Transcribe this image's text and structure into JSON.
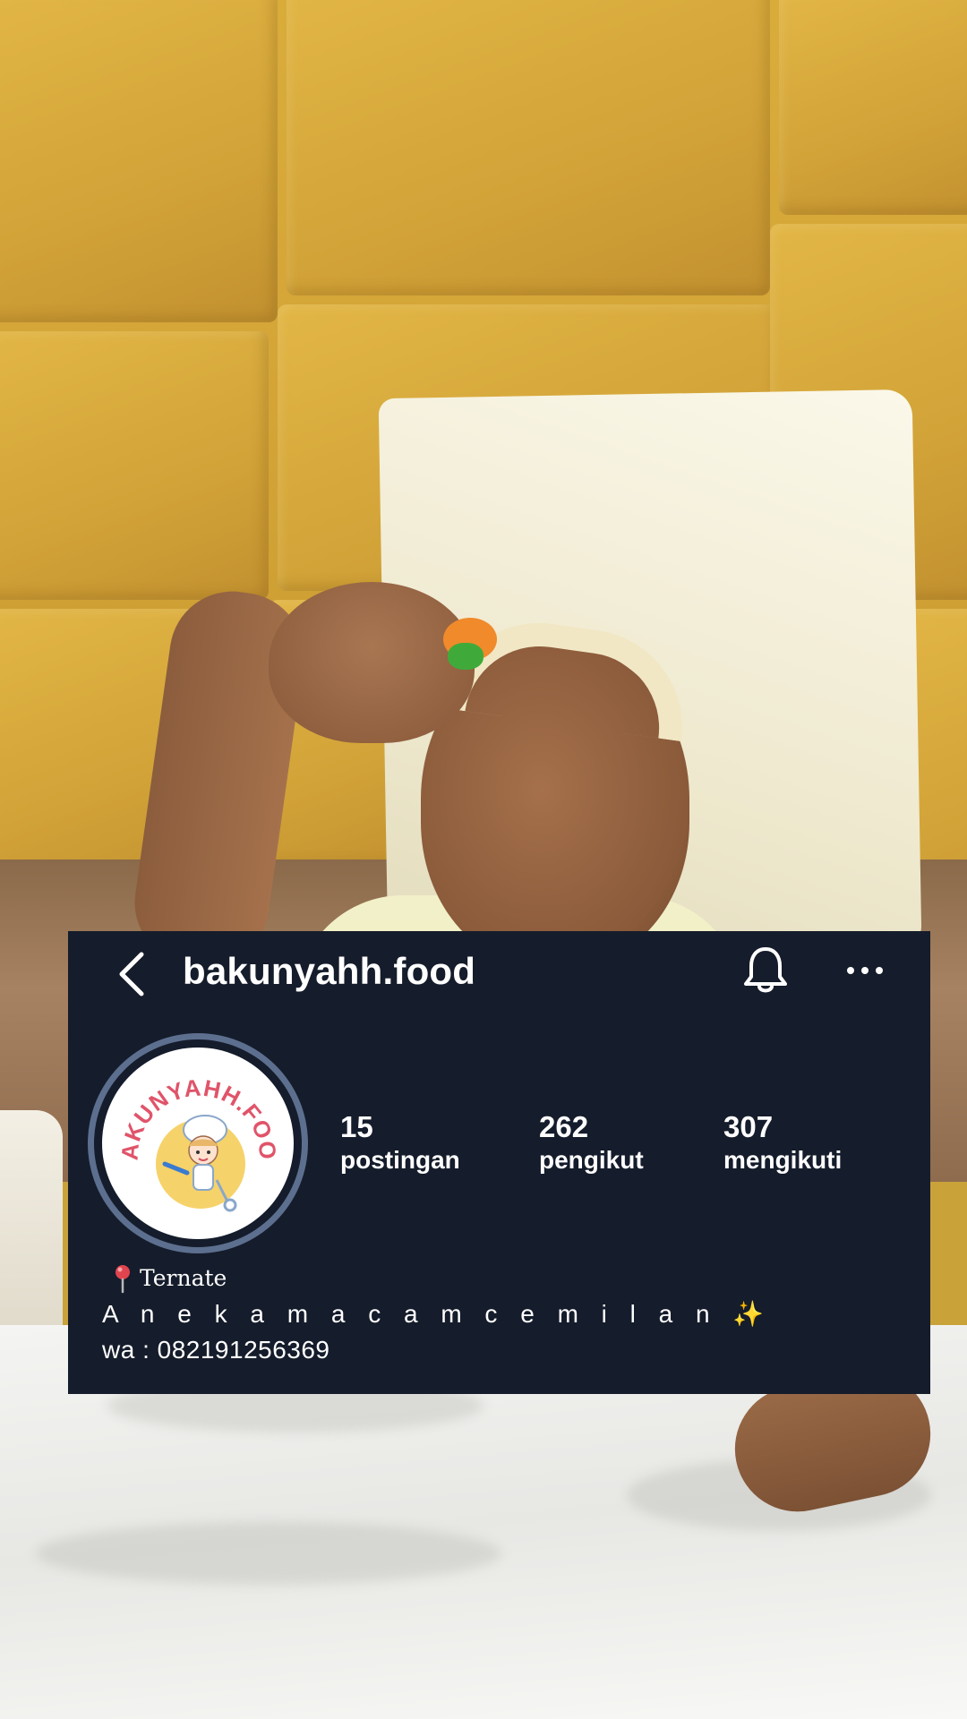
{
  "profile": {
    "username": "bakunyahh.food",
    "avatar_text": "BAKUNYAHH.FOOD",
    "stats": [
      {
        "value": "15",
        "label": "postingan"
      },
      {
        "value": "262",
        "label": "pengikut"
      },
      {
        "value": "307",
        "label": "mengikuti"
      }
    ],
    "bio": {
      "location": "Ternate",
      "description": "A n e k a m a c a m c e m i l a n",
      "sparkle": "✨",
      "whatsapp": "wa : 082191256369"
    }
  },
  "colors": {
    "card_background": "#151c2b",
    "avatar_ring": "#5d6f8f",
    "avatar_text": "#e0546a",
    "text": "#ffffff"
  },
  "icons": {
    "back": "back-chevron-icon",
    "notifications": "bell-icon",
    "more": "more-horizontal-icon",
    "location": "pin-icon"
  }
}
